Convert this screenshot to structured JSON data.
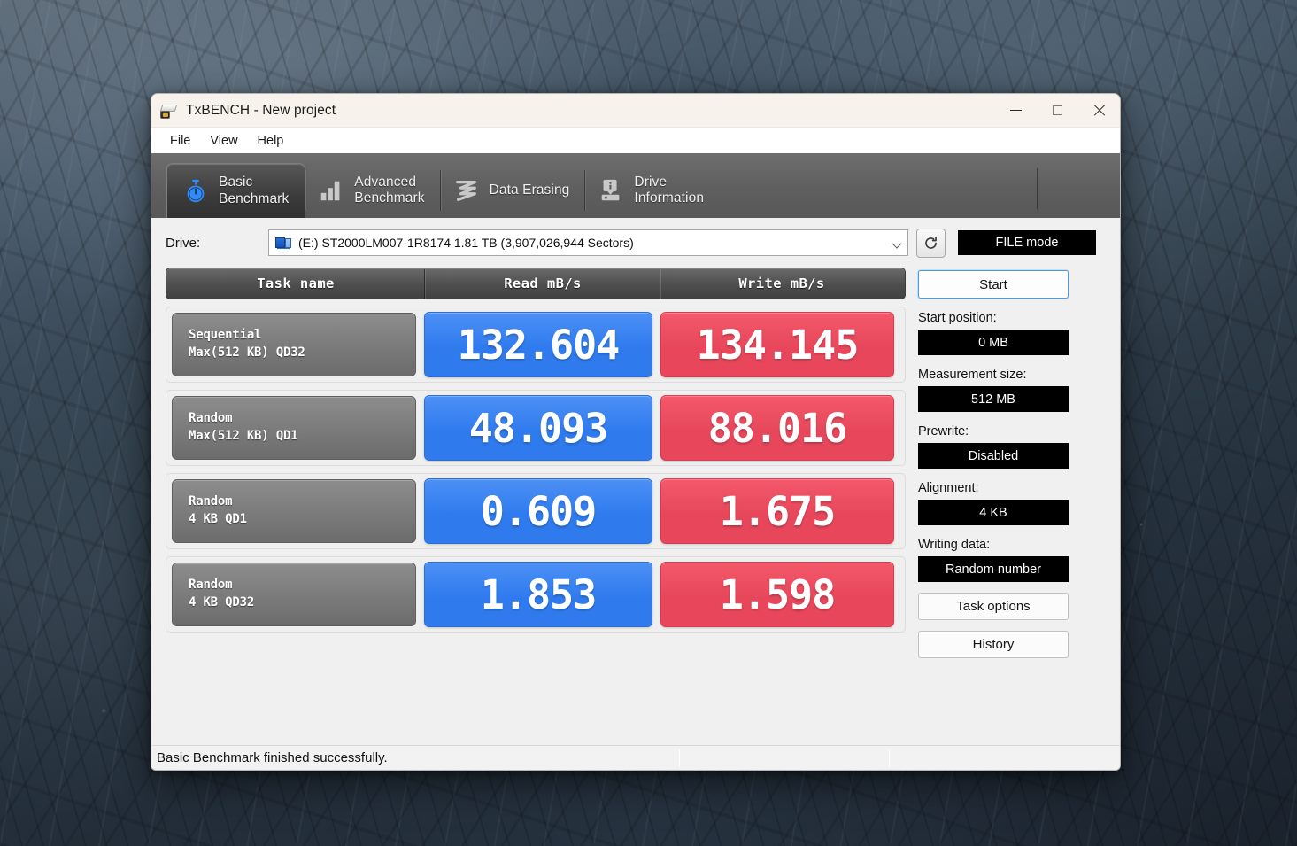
{
  "window": {
    "title": "TxBENCH - New project",
    "icon": "txbench-app-icon",
    "controls": {
      "minimize": "—",
      "maximize": "☐",
      "close": "✕"
    }
  },
  "menubar": {
    "items": [
      "File",
      "View",
      "Help"
    ]
  },
  "tabs": [
    {
      "id": "basic-benchmark",
      "label": "Basic\nBenchmark",
      "icon": "stopwatch-icon",
      "active": true
    },
    {
      "id": "advanced-benchmark",
      "label": "Advanced\nBenchmark",
      "icon": "bar-chart-icon",
      "active": false
    },
    {
      "id": "data-erasing",
      "label": "Data Erasing",
      "icon": "shredder-icon",
      "active": false
    },
    {
      "id": "drive-information",
      "label": "Drive\nInformation",
      "icon": "drive-info-icon",
      "active": false
    }
  ],
  "drive_bar": {
    "label": "Drive:",
    "selected": "(E:) ST2000LM007-1R8174  1.81 TB (3,907,026,944 Sectors)",
    "refresh_icon": "refresh-icon",
    "mode_badge": "FILE mode"
  },
  "results_table": {
    "columns": [
      "Task name",
      "Read mB/s",
      "Write mB/s"
    ],
    "rows": [
      {
        "task_line1": "Sequential",
        "task_line2": "Max(512 KB) QD32",
        "read": "132.604",
        "write": "134.145"
      },
      {
        "task_line1": "Random",
        "task_line2": "Max(512 KB) QD1",
        "read": "48.093",
        "write": "88.016"
      },
      {
        "task_line1": "Random",
        "task_line2": "4 KB QD1",
        "read": "0.609",
        "write": "1.675"
      },
      {
        "task_line1": "Random",
        "task_line2": "4 KB QD32",
        "read": "1.853",
        "write": "1.598"
      }
    ]
  },
  "side_panel": {
    "start_button": "Start",
    "fields": [
      {
        "label": "Start position:",
        "value": "0 MB"
      },
      {
        "label": "Measurement size:",
        "value": "512 MB"
      },
      {
        "label": "Prewrite:",
        "value": "Disabled"
      },
      {
        "label": "Alignment:",
        "value": "4 KB"
      },
      {
        "label": "Writing data:",
        "value": "Random number"
      }
    ],
    "task_options_button": "Task options",
    "history_button": "History"
  },
  "statusbar": {
    "message": "Basic Benchmark finished successfully."
  },
  "colors": {
    "read_cell": "#2f7bee",
    "write_cell": "#e8475b",
    "task_cell": "#7c7c7c",
    "badge_bg": "#000000",
    "accent_border": "#4a9ae0"
  },
  "chart_data": {
    "type": "table",
    "title": "TxBENCH Basic Benchmark Results",
    "categories": [
      "Sequential Max(512 KB) QD32",
      "Random Max(512 KB) QD1",
      "Random 4 KB QD1",
      "Random 4 KB QD32"
    ],
    "series": [
      {
        "name": "Read mB/s",
        "values": [
          132.604,
          48.093,
          0.609,
          1.853
        ]
      },
      {
        "name": "Write mB/s",
        "values": [
          134.145,
          88.016,
          1.675,
          1.598
        ]
      }
    ],
    "xlabel": "Task name",
    "ylabel": "mB/s",
    "legend_position": "header-row"
  }
}
